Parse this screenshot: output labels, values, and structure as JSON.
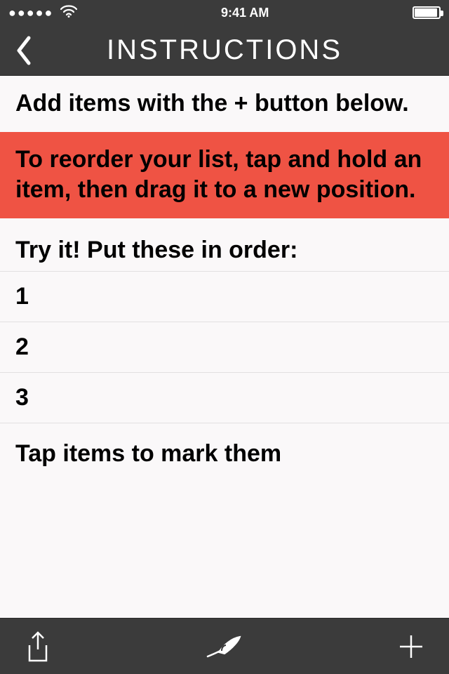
{
  "status": {
    "time": "9:41 AM"
  },
  "nav": {
    "title": "INSTRUCTIONS"
  },
  "rows": {
    "add": "Add items with the + button below.",
    "reorder": "To reorder your list, tap and hold an item, then drag it to a new position.",
    "tryit": "Try it! Put these in order:",
    "n1": "1",
    "n2": "2",
    "n3": "3",
    "mark": "Tap items to mark them"
  },
  "colors": {
    "highlight": "#ef5344",
    "chrome": "#3b3b3b",
    "bg": "#faf8f9"
  }
}
